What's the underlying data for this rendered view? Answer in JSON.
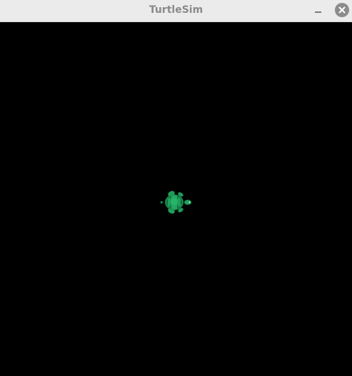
{
  "window": {
    "title": "TurtleSim"
  },
  "titlebar": {
    "minimize_icon": "minimize-icon",
    "close_icon": "close-icon"
  },
  "canvas": {
    "background": "#000000"
  },
  "turtle": {
    "icon": "turtle-icon",
    "color": "#1f9e5b",
    "shell_dark": "#0f6a3a",
    "heading": "right"
  }
}
